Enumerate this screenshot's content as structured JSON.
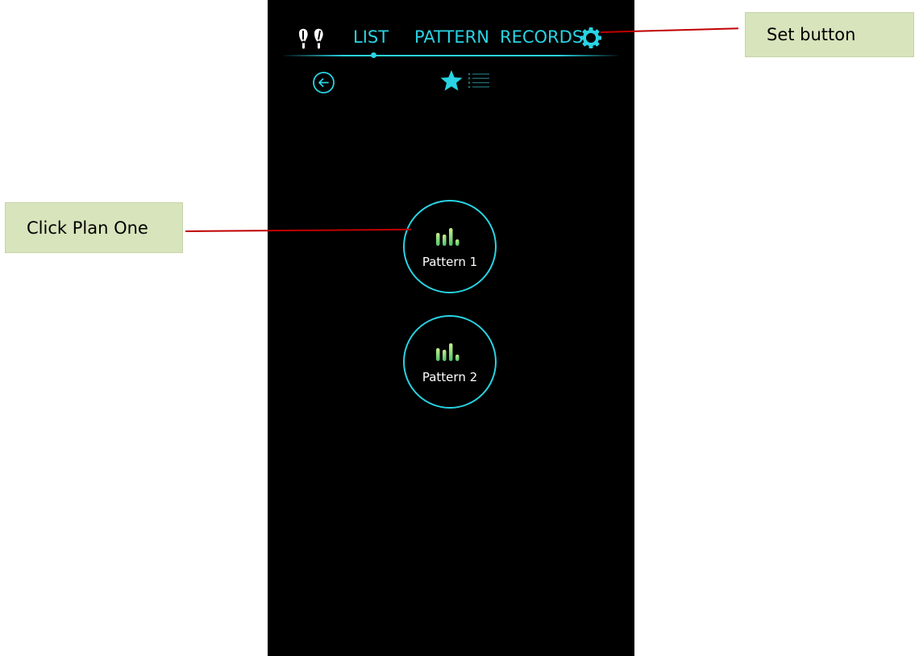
{
  "nav": {
    "tabs": [
      {
        "label": "LIST",
        "active": true
      },
      {
        "label": "PATTERN",
        "active": false
      },
      {
        "label": "RECORDS",
        "active": false
      }
    ],
    "device_icon": "earbuds-icon",
    "settings_icon": "gear-icon",
    "accent_color": "#29d3e3"
  },
  "toolbar": {
    "back_icon": "back-arrow-icon",
    "favorite_icon": "star-icon",
    "list_icon": "list-icon"
  },
  "patterns": [
    {
      "label": "Pattern 1",
      "icon": "bars-icon"
    },
    {
      "label": "Pattern 2",
      "icon": "bars-icon"
    }
  ],
  "annotations": {
    "set_button": "Set button",
    "click_plan_one": "Click Plan One",
    "callout_color": "#d8e4bc",
    "pointer_color": "#c00000"
  }
}
